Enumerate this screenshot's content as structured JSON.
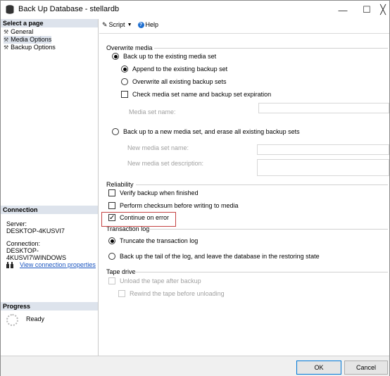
{
  "window": {
    "title": "Back Up Database - stellardb",
    "minimize": "—",
    "maximize": "☐",
    "close": "╳"
  },
  "left": {
    "select_page": "Select a page",
    "pages": [
      {
        "label": "General"
      },
      {
        "label": "Media Options"
      },
      {
        "label": "Backup Options"
      }
    ],
    "connection": {
      "header": "Connection",
      "server_label": "Server:",
      "server_value": "DESKTOP-4KUSVI7",
      "connection_label": "Connection:",
      "connection_value": "DESKTOP-4KUSVI7\\WINDOWS",
      "view_link": "View connection properties"
    },
    "progress": {
      "header": "Progress",
      "status": "Ready"
    }
  },
  "toolbar": {
    "script": "Script",
    "help": "Help"
  },
  "overwrite": {
    "title": "Overwrite media",
    "existing": "Back up to the existing media set",
    "append": "Append to the existing backup set",
    "overwrite_all": "Overwrite all existing backup sets",
    "check_name": "Check media set name and backup set expiration",
    "media_set_name": "Media set name:",
    "new_media": "Back up to a new media set, and erase all existing backup sets",
    "new_name": "New media set name:",
    "new_desc": "New media set description:"
  },
  "reliability": {
    "title": "Reliability",
    "verify": "Verify backup when finished",
    "checksum": "Perform checksum before writing to media",
    "continue": "Continue on error"
  },
  "tlog": {
    "title": "Transaction log",
    "truncate": "Truncate the transaction log",
    "tail": "Back up the tail of the log, and leave the database in the restoring state"
  },
  "tape": {
    "title": "Tape drive",
    "unload": "Unload the tape after backup",
    "rewind": "Rewind the tape before unloading"
  },
  "footer": {
    "ok": "OK",
    "cancel": "Cancel"
  }
}
